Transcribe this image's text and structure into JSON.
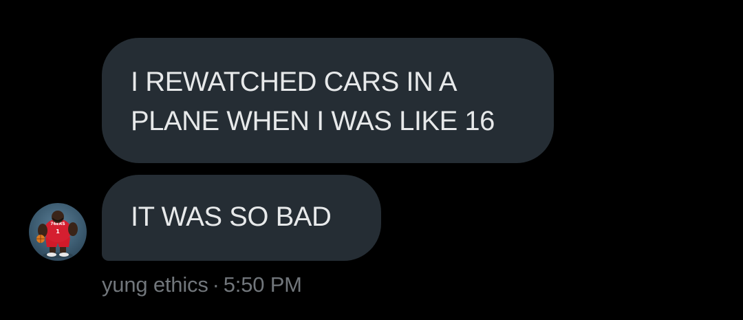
{
  "messages": [
    {
      "lines": [
        "I REWATCHED CARS IN A",
        "PLANE WHEN I WAS LIKE 16"
      ]
    },
    {
      "lines": [
        "IT WAS SO BAD"
      ]
    }
  ],
  "sender": {
    "name": "yung ethics",
    "separator": "·",
    "time": "5:50 PM",
    "avatar_icon": "basketball-player-avatar-icon"
  },
  "colors": {
    "background": "#000000",
    "bubble": "#252d34",
    "bubble_text": "#e7e9ea",
    "meta_text": "#71767b"
  }
}
